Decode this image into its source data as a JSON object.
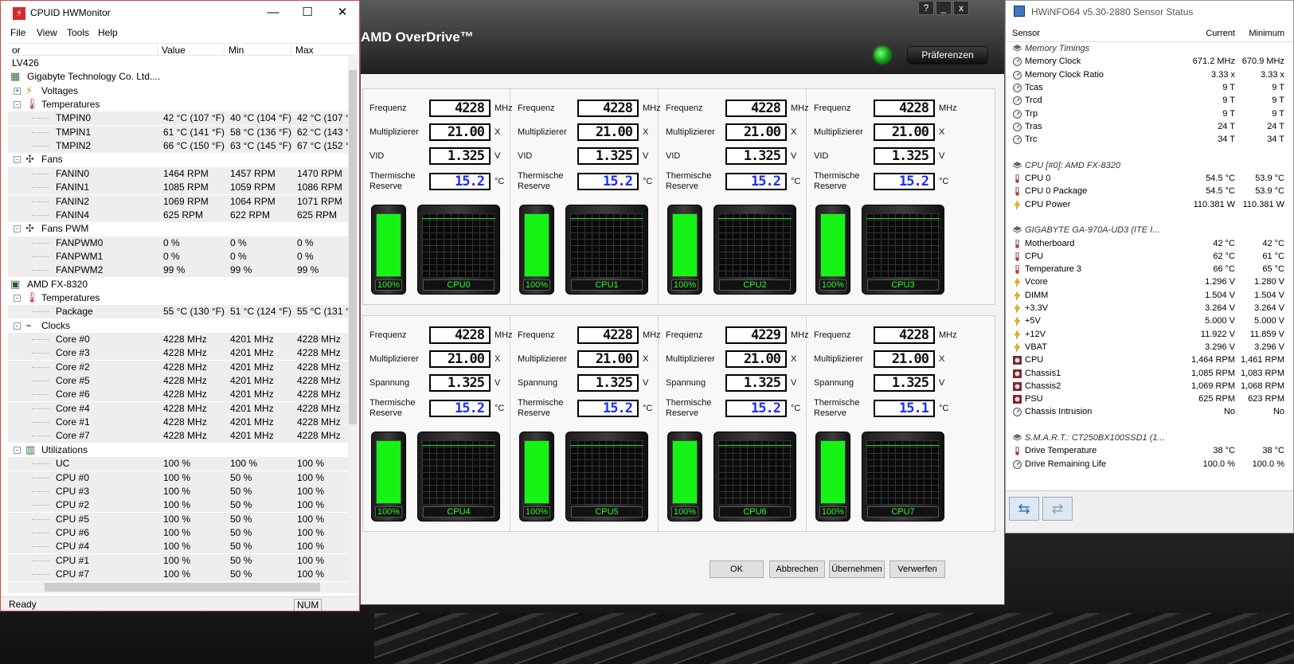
{
  "amd": {
    "title": "AMD OverDrive™",
    "help": "?",
    "minimize": "_",
    "close": "x",
    "preferences": "Präferenzen",
    "buttons": {
      "ok": "OK",
      "cancel": "Abbrechen",
      "apply": "Übernehmen",
      "discard": "Verwerfen"
    },
    "labels": {
      "freq": "Frequenz",
      "mult": "Multiplizierer",
      "vid": "VID",
      "volt": "Spannung",
      "thermal": "Thermische Reserve"
    },
    "units": {
      "freq": "MHz",
      "mult": "X",
      "volt": "V",
      "temp": "°C"
    },
    "cores": [
      {
        "name": "CPU0",
        "freq": "4228",
        "mult": "21.00",
        "volt": "1.325",
        "thermal": "15.2",
        "load": "100%",
        "load_level": 100
      },
      {
        "name": "CPU1",
        "freq": "4228",
        "mult": "21.00",
        "volt": "1.325",
        "thermal": "15.2",
        "load": "100%",
        "load_level": 100
      },
      {
        "name": "CPU2",
        "freq": "4228",
        "mult": "21.00",
        "volt": "1.325",
        "thermal": "15.2",
        "load": "100%",
        "load_level": 100
      },
      {
        "name": "CPU3",
        "freq": "4228",
        "mult": "21.00",
        "volt": "1.325",
        "thermal": "15.2",
        "load": "100%",
        "load_level": 100
      },
      {
        "name": "CPU4",
        "freq": "4228",
        "mult": "21.00",
        "volt": "1.325",
        "thermal": "15.2",
        "load": "100%",
        "load_level": 100
      },
      {
        "name": "CPU5",
        "freq": "4228",
        "mult": "21.00",
        "volt": "1.325",
        "thermal": "15.2",
        "load": "100%",
        "load_level": 100
      },
      {
        "name": "CPU6",
        "freq": "4229",
        "mult": "21.00",
        "volt": "1.325",
        "thermal": "15.2",
        "load": "100%",
        "load_level": 100
      },
      {
        "name": "CPU7",
        "freq": "4228",
        "mult": "21.00",
        "volt": "1.325",
        "thermal": "15.1",
        "load": "100%",
        "load_level": 100
      }
    ]
  },
  "hwmonitor": {
    "title": "CPUID HWMonitor",
    "app_icon": "⚡",
    "win_min": "—",
    "win_max": "☐",
    "win_close": "✕",
    "menu": [
      "File",
      "View",
      "Tools",
      "Help"
    ],
    "columns": [
      "or",
      "Value",
      "Min",
      "Max"
    ],
    "rows": [
      {
        "level": 0,
        "text": "LV426",
        "icon": "",
        "exp": ""
      },
      {
        "level": 0,
        "text": "Gigabyte Technology Co. Ltd....",
        "icon": "motherboard-icon",
        "exp": ""
      },
      {
        "level": 1,
        "text": "Voltages",
        "icon": "voltage-icon",
        "exp": "+"
      },
      {
        "level": 1,
        "text": "Temperatures",
        "icon": "thermometer-icon",
        "exp": "-"
      },
      {
        "level": 2,
        "text": "TMPIN0",
        "value": "42 °C (107 °F)",
        "min": "40 °C (104 °F)",
        "max": "42 °C (107 °",
        "shade": true
      },
      {
        "level": 2,
        "text": "TMPIN1",
        "value": "61 °C (141 °F)",
        "min": "58 °C (136 °F)",
        "max": "62 °C (143 °",
        "shade": true
      },
      {
        "level": 2,
        "text": "TMPIN2",
        "value": "66 °C (150 °F)",
        "min": "63 °C (145 °F)",
        "max": "67 °C (152 °",
        "shade": true
      },
      {
        "level": 1,
        "text": "Fans",
        "icon": "fan-icon",
        "exp": "-"
      },
      {
        "level": 2,
        "text": "FANIN0",
        "value": "1464 RPM",
        "min": "1457 RPM",
        "max": "1470 RPM",
        "shade": true
      },
      {
        "level": 2,
        "text": "FANIN1",
        "value": "1085 RPM",
        "min": "1059 RPM",
        "max": "1086 RPM",
        "shade": true
      },
      {
        "level": 2,
        "text": "FANIN2",
        "value": "1069 RPM",
        "min": "1064 RPM",
        "max": "1071 RPM",
        "shade": true
      },
      {
        "level": 2,
        "text": "FANIN4",
        "value": "625 RPM",
        "min": "622 RPM",
        "max": "625 RPM",
        "shade": true
      },
      {
        "level": 1,
        "text": "Fans PWM",
        "icon": "fan-icon",
        "exp": "-"
      },
      {
        "level": 2,
        "text": "FANPWM0",
        "value": "0 %",
        "min": "0 %",
        "max": "0 %",
        "shade": true
      },
      {
        "level": 2,
        "text": "FANPWM1",
        "value": "0 %",
        "min": "0 %",
        "max": "0 %",
        "shade": true
      },
      {
        "level": 2,
        "text": "FANPWM2",
        "value": "99 %",
        "min": "99 %",
        "max": "99 %",
        "shade": true
      },
      {
        "level": 0,
        "text": "AMD FX-8320",
        "icon": "cpu-icon",
        "exp": ""
      },
      {
        "level": 1,
        "text": "Temperatures",
        "icon": "thermometer-icon",
        "exp": "-"
      },
      {
        "level": 2,
        "text": "Package",
        "value": "55 °C (130 °F)",
        "min": "51 °C (124 °F)",
        "max": "55 °C (131 °",
        "shade": true
      },
      {
        "level": 1,
        "text": "Clocks",
        "icon": "clock-icon",
        "exp": "-"
      },
      {
        "level": 2,
        "text": "Core #0",
        "value": "4228 MHz",
        "min": "4201 MHz",
        "max": "4228 MHz",
        "shade": true
      },
      {
        "level": 2,
        "text": "Core #3",
        "value": "4228 MHz",
        "min": "4201 MHz",
        "max": "4228 MHz",
        "shade": true
      },
      {
        "level": 2,
        "text": "Core #2",
        "value": "4228 MHz",
        "min": "4201 MHz",
        "max": "4228 MHz",
        "shade": true
      },
      {
        "level": 2,
        "text": "Core #5",
        "value": "4228 MHz",
        "min": "4201 MHz",
        "max": "4228 MHz",
        "shade": true
      },
      {
        "level": 2,
        "text": "Core #6",
        "value": "4228 MHz",
        "min": "4201 MHz",
        "max": "4228 MHz",
        "shade": true
      },
      {
        "level": 2,
        "text": "Core #4",
        "value": "4228 MHz",
        "min": "4201 MHz",
        "max": "4228 MHz",
        "shade": true
      },
      {
        "level": 2,
        "text": "Core #1",
        "value": "4228 MHz",
        "min": "4201 MHz",
        "max": "4228 MHz",
        "shade": true
      },
      {
        "level": 2,
        "text": "Core #7",
        "value": "4228 MHz",
        "min": "4201 MHz",
        "max": "4228 MHz",
        "shade": true
      },
      {
        "level": 1,
        "text": "Utilizations",
        "icon": "utilization-icon",
        "exp": "-"
      },
      {
        "level": 2,
        "text": "UC",
        "value": "100 %",
        "min": "100 %",
        "max": "100 %",
        "shade": true
      },
      {
        "level": 2,
        "text": "CPU #0",
        "value": "100 %",
        "min": "50 %",
        "max": "100 %",
        "shade": true
      },
      {
        "level": 2,
        "text": "CPU #3",
        "value": "100 %",
        "min": "50 %",
        "max": "100 %",
        "shade": true
      },
      {
        "level": 2,
        "text": "CPU #2",
        "value": "100 %",
        "min": "50 %",
        "max": "100 %",
        "shade": true
      },
      {
        "level": 2,
        "text": "CPU #5",
        "value": "100 %",
        "min": "50 %",
        "max": "100 %",
        "shade": true
      },
      {
        "level": 2,
        "text": "CPU #6",
        "value": "100 %",
        "min": "50 %",
        "max": "100 %",
        "shade": true
      },
      {
        "level": 2,
        "text": "CPU #4",
        "value": "100 %",
        "min": "50 %",
        "max": "100 %",
        "shade": true
      },
      {
        "level": 2,
        "text": "CPU #1",
        "value": "100 %",
        "min": "50 %",
        "max": "100 %",
        "shade": true
      },
      {
        "level": 2,
        "text": "CPU #7",
        "value": "100 %",
        "min": "50 %",
        "max": "100 %",
        "shade": true
      }
    ],
    "status_ready": "Ready",
    "status_num": "NUM"
  },
  "hwinfo": {
    "title": "HWiNFO64 v5.30-2880 Sensor Status",
    "columns": [
      "Sensor",
      "Current",
      "Minimum"
    ],
    "rows": [
      {
        "type": "group",
        "name": "Memory Timings"
      },
      {
        "name": "Memory Clock",
        "current": "671.2 MHz",
        "min": "670.9 MHz",
        "icon": "clock"
      },
      {
        "name": "Memory Clock Ratio",
        "current": "3.33 x",
        "min": "3.33 x",
        "icon": "clock"
      },
      {
        "name": "Tcas",
        "current": "9 T",
        "min": "9 T",
        "icon": "clock"
      },
      {
        "name": "Trcd",
        "current": "9 T",
        "min": "9 T",
        "icon": "clock"
      },
      {
        "name": "Trp",
        "current": "9 T",
        "min": "9 T",
        "icon": "clock"
      },
      {
        "name": "Tras",
        "current": "24 T",
        "min": "24 T",
        "icon": "clock"
      },
      {
        "name": "Trc",
        "current": "34 T",
        "min": "34 T",
        "icon": "clock"
      },
      {
        "type": "spacer"
      },
      {
        "type": "group",
        "name": "CPU [#0]: AMD FX-8320"
      },
      {
        "name": "CPU 0",
        "current": "54.5 °C",
        "min": "53.9 °C",
        "icon": "temp"
      },
      {
        "name": "CPU 0 Package",
        "current": "54.5 °C",
        "min": "53.9 °C",
        "icon": "temp"
      },
      {
        "name": "CPU Power",
        "current": "110.381 W",
        "min": "110.381 W",
        "icon": "power"
      },
      {
        "type": "spacer"
      },
      {
        "type": "group",
        "name": "GIGABYTE GA-970A-UD3 (ITE I..."
      },
      {
        "name": "Motherboard",
        "current": "42 °C",
        "min": "42 °C",
        "icon": "temp"
      },
      {
        "name": "CPU",
        "current": "62 °C",
        "min": "61 °C",
        "icon": "temp"
      },
      {
        "name": "Temperature 3",
        "current": "66 °C",
        "min": "65 °C",
        "icon": "temp"
      },
      {
        "name": "Vcore",
        "current": "1.296 V",
        "min": "1.280 V",
        "icon": "power"
      },
      {
        "name": "DIMM",
        "current": "1.504 V",
        "min": "1.504 V",
        "icon": "power"
      },
      {
        "name": "+3.3V",
        "current": "3.264 V",
        "min": "3.264 V",
        "icon": "power"
      },
      {
        "name": "+5V",
        "current": "5.000 V",
        "min": "5.000 V",
        "icon": "power"
      },
      {
        "name": "+12V",
        "current": "11.922 V",
        "min": "11.859 V",
        "icon": "power"
      },
      {
        "name": "VBAT",
        "current": "3.296 V",
        "min": "3.296 V",
        "icon": "power"
      },
      {
        "name": "CPU",
        "current": "1,464 RPM",
        "min": "1,461 RPM",
        "icon": "fan"
      },
      {
        "name": "Chassis1",
        "current": "1,085 RPM",
        "min": "1,083 RPM",
        "icon": "fan"
      },
      {
        "name": "Chassis2",
        "current": "1,069 RPM",
        "min": "1,068 RPM",
        "icon": "fan"
      },
      {
        "name": "PSU",
        "current": "625 RPM",
        "min": "623 RPM",
        "icon": "fan"
      },
      {
        "name": "Chassis Intrusion",
        "current": "No",
        "min": "No",
        "icon": "clock"
      },
      {
        "type": "spacer"
      },
      {
        "type": "group",
        "name": "S.M.A.R.T.: CT250BX100SSD1 (1..."
      },
      {
        "name": "Drive Temperature",
        "current": "38 °C",
        "min": "38 °C",
        "icon": "temp"
      },
      {
        "name": "Drive Remaining Life",
        "current": "100.0 %",
        "min": "100.0 %",
        "icon": "clock"
      }
    ]
  },
  "colors": {
    "led": "#16f416",
    "hwm_border": "#c74b4b",
    "lcd_blue": "#1b2cff"
  }
}
